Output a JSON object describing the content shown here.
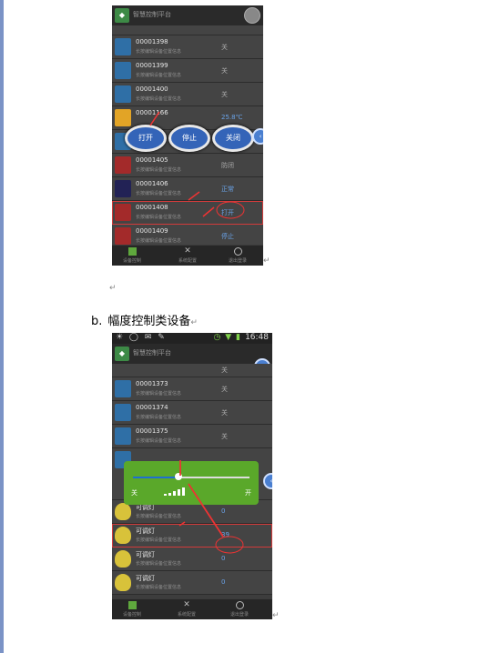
{
  "heading": {
    "prefix": "b.",
    "text": "幅度控制类设备"
  },
  "para_mark": "↵",
  "app": {
    "title": "智慧控制平台",
    "subtitle": "长按编辑设备位置信息",
    "status": {
      "time": "16:48"
    }
  },
  "nav": {
    "tabs": [
      "设备控制",
      "系统配置",
      "退出登录"
    ]
  },
  "phone1": {
    "rows": [
      {
        "name": "00001398",
        "state": "关"
      },
      {
        "name": "00001399",
        "state": "关"
      },
      {
        "name": "00001400",
        "state": "关"
      },
      {
        "name": "000011",
        "name_tail": "66",
        "state": "25.8℃"
      },
      {
        "name": "",
        "state": ""
      },
      {
        "name": "00001405",
        "state": "防闭"
      },
      {
        "name": "00001406",
        "state": "正常"
      },
      {
        "name": "00001408",
        "state": "打开"
      },
      {
        "name": "00001409",
        "state": "停止"
      }
    ],
    "popup_buttons": [
      "打开",
      "停止",
      "关闭"
    ]
  },
  "phone2": {
    "rows": [
      {
        "name": "",
        "state": "关"
      },
      {
        "name": "00001373",
        "state": "关"
      },
      {
        "name": "00001374",
        "state": "关"
      },
      {
        "name": "00001375",
        "state": "关"
      },
      {
        "name": "可调灯",
        "state": "0"
      },
      {
        "name": "可调灯",
        "state": "39"
      },
      {
        "name": "可调灯",
        "state": "0"
      },
      {
        "name": "可调灯",
        "state": "0"
      }
    ],
    "slider": {
      "min_label": "关",
      "max_label": "开",
      "level": 0.39
    }
  }
}
